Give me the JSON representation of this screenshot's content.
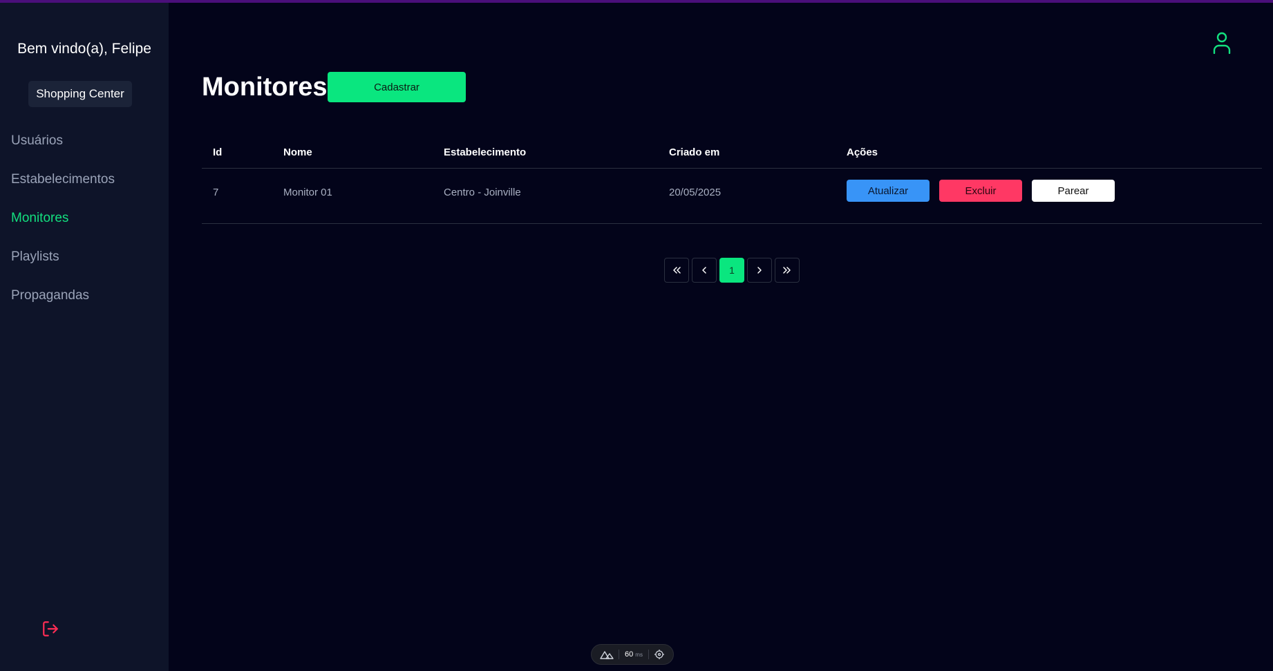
{
  "sidebar": {
    "welcome": "Bem vindo(a), Felipe",
    "org": "Shopping Center",
    "items": [
      {
        "label": "Usuários",
        "active": false
      },
      {
        "label": "Estabelecimentos",
        "active": false
      },
      {
        "label": "Monitores",
        "active": true
      },
      {
        "label": "Playlists",
        "active": false
      },
      {
        "label": "Propagandas",
        "active": false
      }
    ]
  },
  "main": {
    "title": "Monitores",
    "create_label": "Cadastrar",
    "table": {
      "headers": [
        "Id",
        "Nome",
        "Estabelecimento",
        "Criado em",
        "Ações"
      ],
      "rows": [
        {
          "id": "7",
          "nome": "Monitor 01",
          "estabelecimento": "Centro - Joinville",
          "criado_em": "20/05/2025"
        }
      ],
      "actions": {
        "update": "Atualizar",
        "delete": "Excluir",
        "pair": "Parear"
      }
    },
    "pagination": {
      "current": "1"
    }
  },
  "devtools": {
    "ms_value": "60",
    "ms_unit": "ms"
  },
  "colors": {
    "accent": "#0ae67f",
    "update": "#3894f7",
    "delete": "#ff3864",
    "logout": "#ff2d55"
  }
}
